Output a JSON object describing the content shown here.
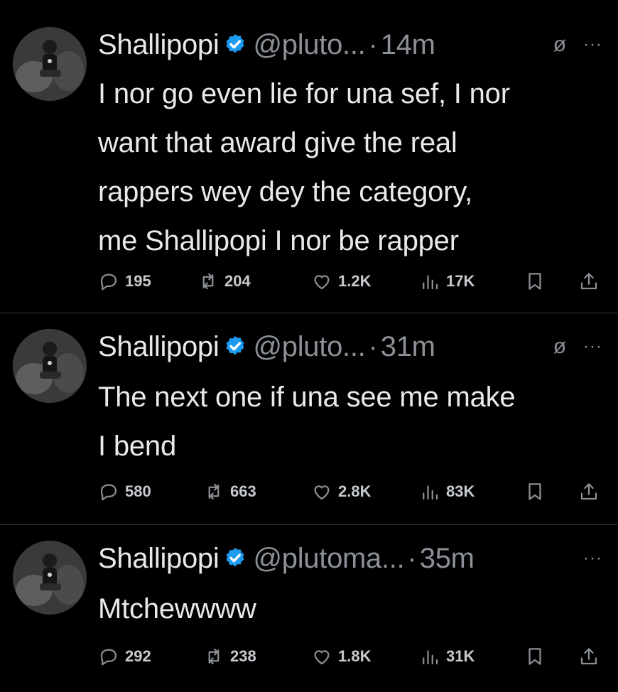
{
  "tweets": [
    {
      "name": "Shallipopi",
      "handle": "@pluto...",
      "time": "14m",
      "show_noreply": true,
      "text_lines": [
        "I nor go even lie for una sef, I nor",
        "want that award give the real",
        "rappers wey dey the category,",
        "me Shallipopi I nor be rapper"
      ],
      "replies": "195",
      "retweets": "204",
      "likes": "1.2K",
      "views": "17K"
    },
    {
      "name": "Shallipopi",
      "handle": "@pluto...",
      "time": "31m",
      "show_noreply": true,
      "text_lines": [
        "The next one if una see me make",
        "I bend"
      ],
      "replies": "580",
      "retweets": "663",
      "likes": "2.8K",
      "views": "83K"
    },
    {
      "name": "Shallipopi",
      "handle": "@plutoma...",
      "time": "35m",
      "show_noreply": false,
      "text_lines": [
        "Mtchewwww"
      ],
      "replies": "292",
      "retweets": "238",
      "likes": "1.8K",
      "views": "31K"
    }
  ],
  "icons": {
    "verified": "verified-badge-icon",
    "noreply": "no-reply-icon",
    "more": "more-options-icon",
    "reply": "reply-icon",
    "retweet": "retweet-icon",
    "like": "heart-icon",
    "views": "views-icon",
    "bookmark": "bookmark-icon",
    "share": "share-icon"
  },
  "colors": {
    "background": "#000000",
    "text": "#e7e9ea",
    "muted": "#8b9096",
    "verified": "#1d9bf0",
    "divider": "#2f3336"
  },
  "glyphs": {
    "noreply": "ø",
    "more": "···",
    "dot": "·"
  }
}
